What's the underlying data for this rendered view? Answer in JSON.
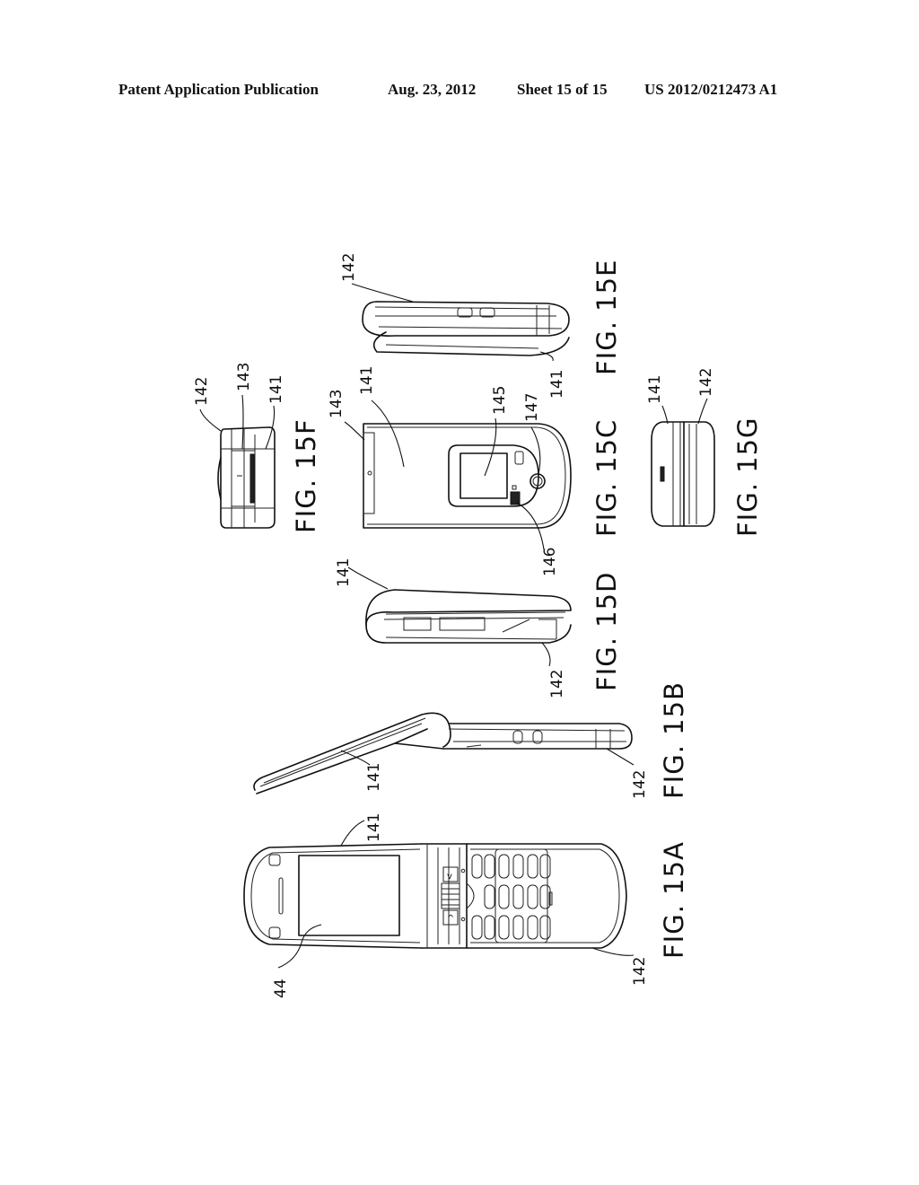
{
  "header": {
    "publication_type": "Patent Application Publication",
    "date": "Aug. 23, 2012",
    "sheet": "Sheet 15 of 15",
    "publication_number": "US 2012/0212473 A1"
  },
  "figures": [
    {
      "id": "15A",
      "label": "FIG. 15A",
      "view": "open flip phone, front",
      "refs": [
        "141",
        "44",
        "142"
      ]
    },
    {
      "id": "15B",
      "label": "FIG. 15B",
      "view": "open flip phone, side",
      "refs": [
        "141",
        "142"
      ]
    },
    {
      "id": "15C",
      "label": "FIG. 15C",
      "view": "closed phone, outer face",
      "refs": [
        "143",
        "141",
        "145",
        "147",
        "146"
      ]
    },
    {
      "id": "15D",
      "label": "FIG. 15D",
      "view": "closed phone, side",
      "refs": [
        "141",
        "142"
      ]
    },
    {
      "id": "15E",
      "label": "FIG. 15E",
      "view": "closed phone, other side",
      "refs": [
        "142",
        "141"
      ]
    },
    {
      "id": "15F",
      "label": "FIG. 15F",
      "view": "closed phone, hinge end",
      "refs": [
        "142",
        "143",
        "141"
      ]
    },
    {
      "id": "15G",
      "label": "FIG. 15G",
      "view": "closed phone, tip end",
      "refs": [
        "141",
        "142"
      ]
    }
  ]
}
